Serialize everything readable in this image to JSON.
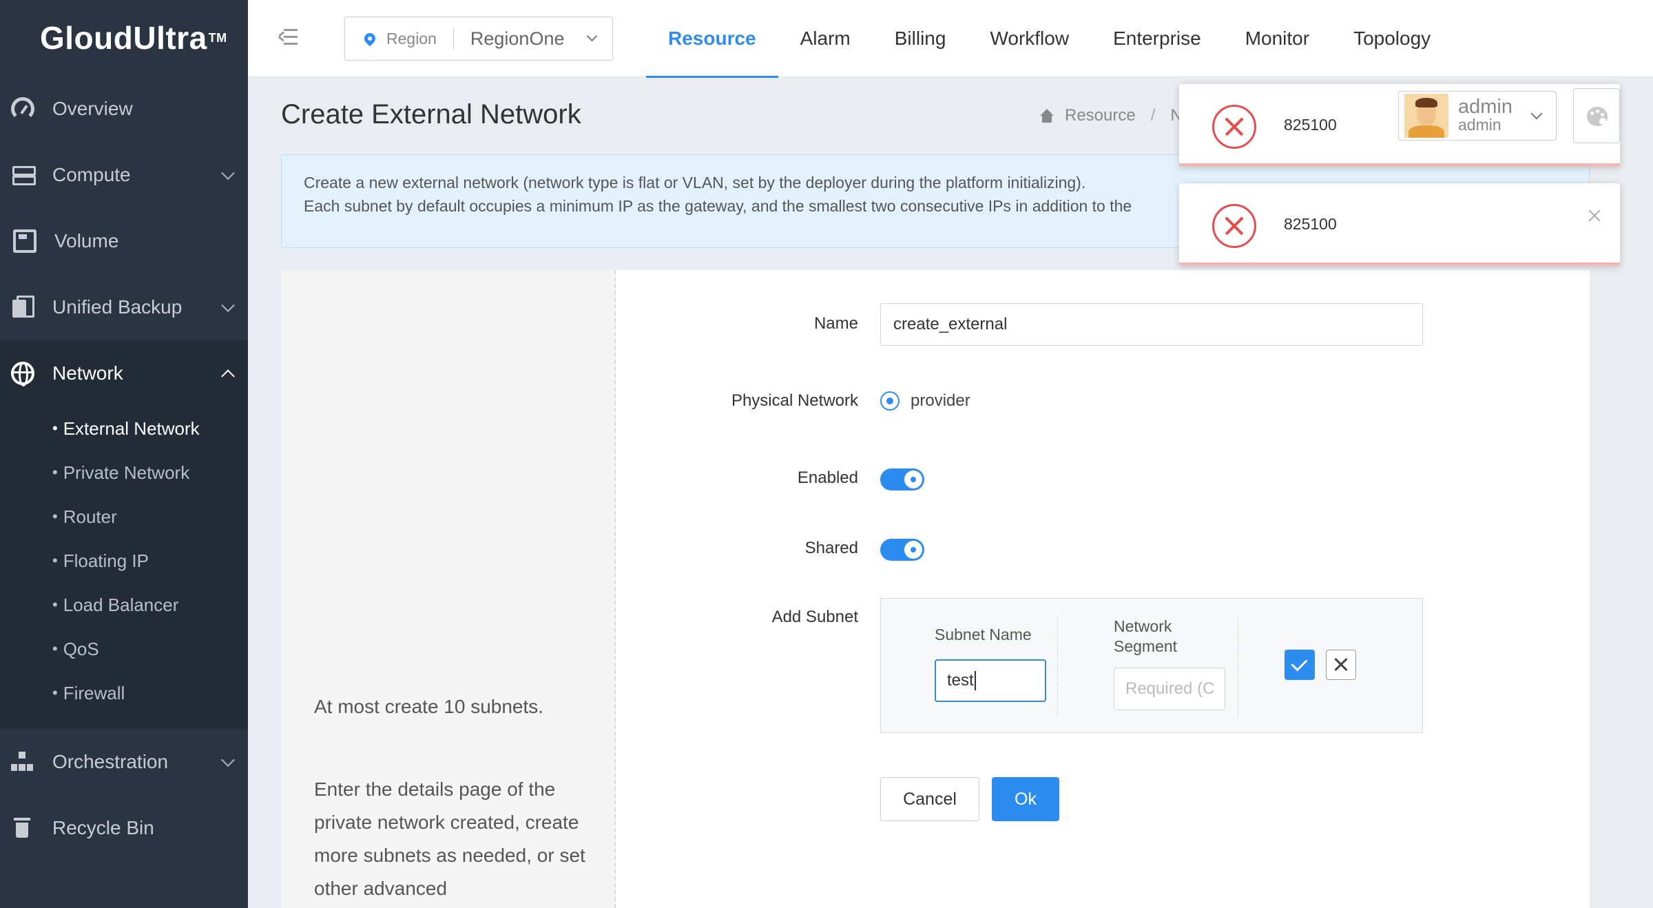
{
  "app": {
    "logo": "GloudUltra",
    "logo_tm": "TM"
  },
  "sidebar": {
    "items": [
      {
        "label": "Overview",
        "icon": "dashboard-icon",
        "expandable": false
      },
      {
        "label": "Compute",
        "icon": "server-icon",
        "expandable": true
      },
      {
        "label": "Volume",
        "icon": "disk-icon",
        "expandable": false
      },
      {
        "label": "Unified Backup",
        "icon": "backup-icon",
        "expandable": true
      },
      {
        "label": "Network",
        "icon": "globe-icon",
        "expandable": true,
        "open": true
      },
      {
        "label": "Orchestration",
        "icon": "sitemap-icon",
        "expandable": true
      },
      {
        "label": "Recycle Bin",
        "icon": "trash-icon",
        "expandable": false
      }
    ],
    "network_submenu": [
      "External Network",
      "Private Network",
      "Router",
      "Floating IP",
      "Load Balancer",
      "QoS",
      "Firewall"
    ],
    "active_submenu": "External Network"
  },
  "topbar": {
    "region_label": "Region",
    "region_value": "RegionOne",
    "tabs": [
      "Resource",
      "Alarm",
      "Billing",
      "Workflow",
      "Enterprise",
      "Monitor",
      "Topology"
    ],
    "active_tab": "Resource"
  },
  "page": {
    "title": "Create External Network",
    "breadcrumb": [
      "Resource",
      "N"
    ]
  },
  "info": {
    "line1": "Create a new external network (network type is flat or VLAN, set by the deployer during the platform initializing).",
    "line2": "Each subnet by default occupies a minimum IP as the gateway, and the smallest two consecutive IPs in addition to the"
  },
  "help": {
    "hint1": "At most create 10 subnets.",
    "hint2": "Enter the details page of the private network created, create more subnets as needed, or set other advanced"
  },
  "form": {
    "name_label": "Name",
    "name_value": "create_external",
    "physical_label": "Physical Network",
    "physical_option": "provider",
    "enabled_label": "Enabled",
    "enabled": true,
    "shared_label": "Shared",
    "shared": true,
    "subnet_label": "Add Subnet",
    "subnet": {
      "name_header": "Subnet Name",
      "name_value": "test",
      "segment_header": "Network Segment",
      "segment_placeholder": "Required (C"
    },
    "cancel_label": "Cancel",
    "ok_label": "Ok"
  },
  "notifications": [
    {
      "message": "825100",
      "type": "error"
    },
    {
      "message": "825100",
      "type": "error"
    }
  ],
  "user": {
    "name": "admin",
    "role": "admin"
  },
  "colors": {
    "primary": "#2d8cf0",
    "sidebar": "#2b3443",
    "error": "#e84b4b",
    "info_bg": "#e3f1fc"
  }
}
